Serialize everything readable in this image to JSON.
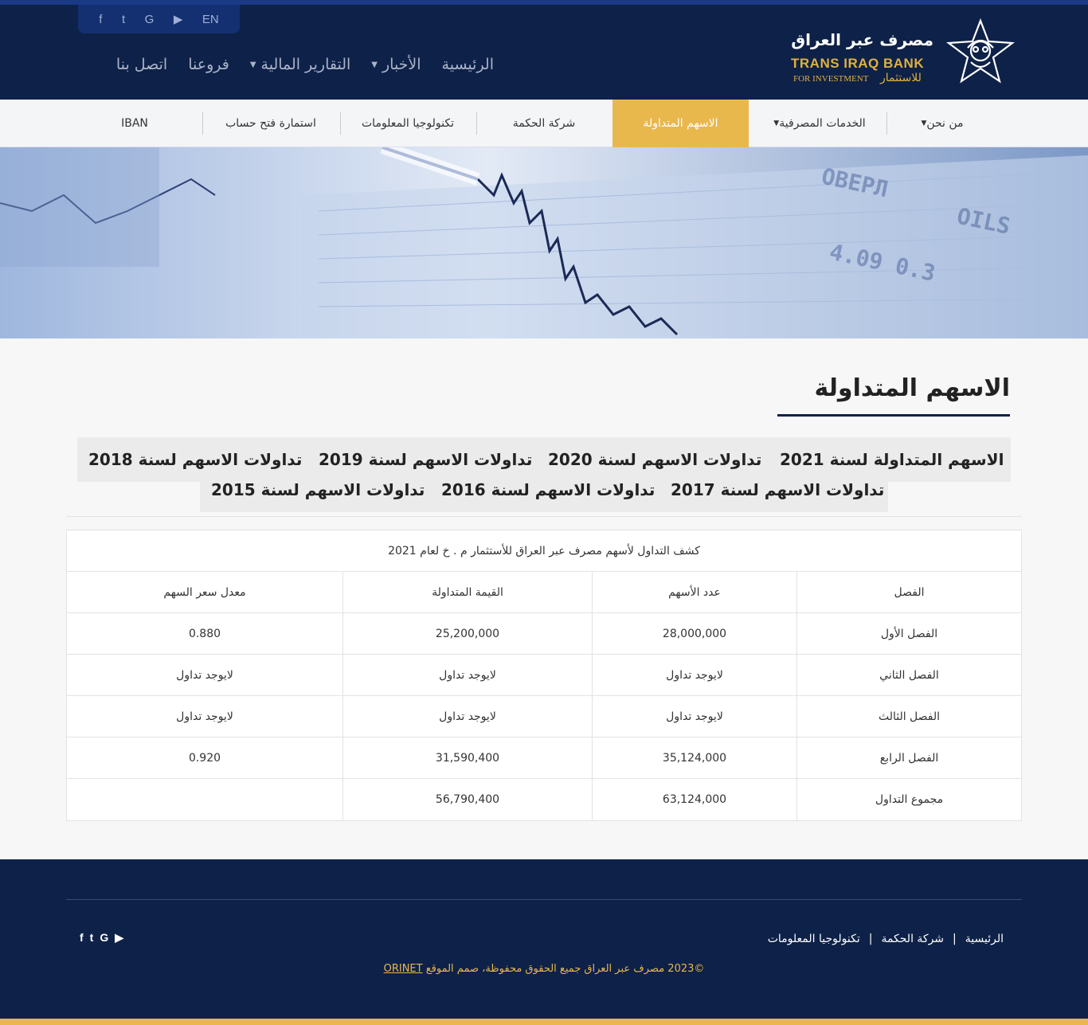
{
  "header": {
    "social": [
      "f",
      "t",
      "G",
      "▶",
      "EN"
    ],
    "social_icons": [
      "facebook-icon",
      "twitter-icon",
      "google-icon",
      "youtube-icon"
    ],
    "lang": "EN",
    "nav": [
      "الرئيسية",
      "الأخبار",
      "التقارير المالية",
      "فروعنا",
      "اتصل بنا"
    ],
    "logo": {
      "arabic": "مصرف عبر العراق",
      "english": "TRANS IRAQ BANK",
      "english_sub": "FOR INVESTMENT",
      "arabic_sub": "للاستثمار"
    }
  },
  "subnav": {
    "items": [
      "من نحن",
      "الخدمات المصرفية",
      "الاسهم المتداولة",
      "شركة الحكمة",
      "تكنولوجيا المعلومات",
      "استمارة فتح حساب",
      "IBAN"
    ]
  },
  "page": {
    "title": "الاسهم المتداولة",
    "tabs": [
      "الاسهم المتداولة لسنة 2021",
      "تداولات الاسهم لسنة 2020",
      "تداولات الاسهم لسنة 2019",
      "تداولات الاسهم لسنة 2018",
      "تداولات الاسهم لسنة 2017",
      "تداولات الاسهم لسنة 2016",
      "تداولات الاسهم لسنة 2015"
    ]
  },
  "table": {
    "caption": "كشف التداول لأسهم مصرف عبر العراق للأستثمار م . خ لعام 2021",
    "headers": [
      "الفصل",
      "عدد الأسهم",
      "القيمة المتداولة",
      "معدل سعر السهم"
    ],
    "rows": [
      [
        "الفصل الأول",
        "28,000,000",
        "25,200,000",
        "0.880"
      ],
      [
        "الفصل الثاني",
        "لايوجد تداول",
        "لايوجد تداول",
        "لايوجد تداول"
      ],
      [
        "الفصل الثالث",
        "لايوجد تداول",
        "لايوجد تداول",
        "لايوجد تداول"
      ],
      [
        "الفصل الرابع",
        "35,124,000",
        "31,590,400",
        "0.920"
      ],
      [
        "مجموع التداول",
        "63,124,000",
        "56,790,400",
        ""
      ]
    ]
  },
  "footer": {
    "nav": [
      "الرئيسية",
      "شركة الحكمة",
      "تكنولوجيا المعلومات"
    ],
    "separator": "|",
    "social": [
      "f",
      "t",
      "G",
      "▶"
    ],
    "copyright": "©2023 مصرف عبر العراق جميع الحقوق محفوظة، صمم الموقع",
    "designer": "ORINET"
  },
  "colors": {
    "navy": "#0e2148",
    "gold": "#e9b84d",
    "active_tab": "#e9b84d"
  }
}
